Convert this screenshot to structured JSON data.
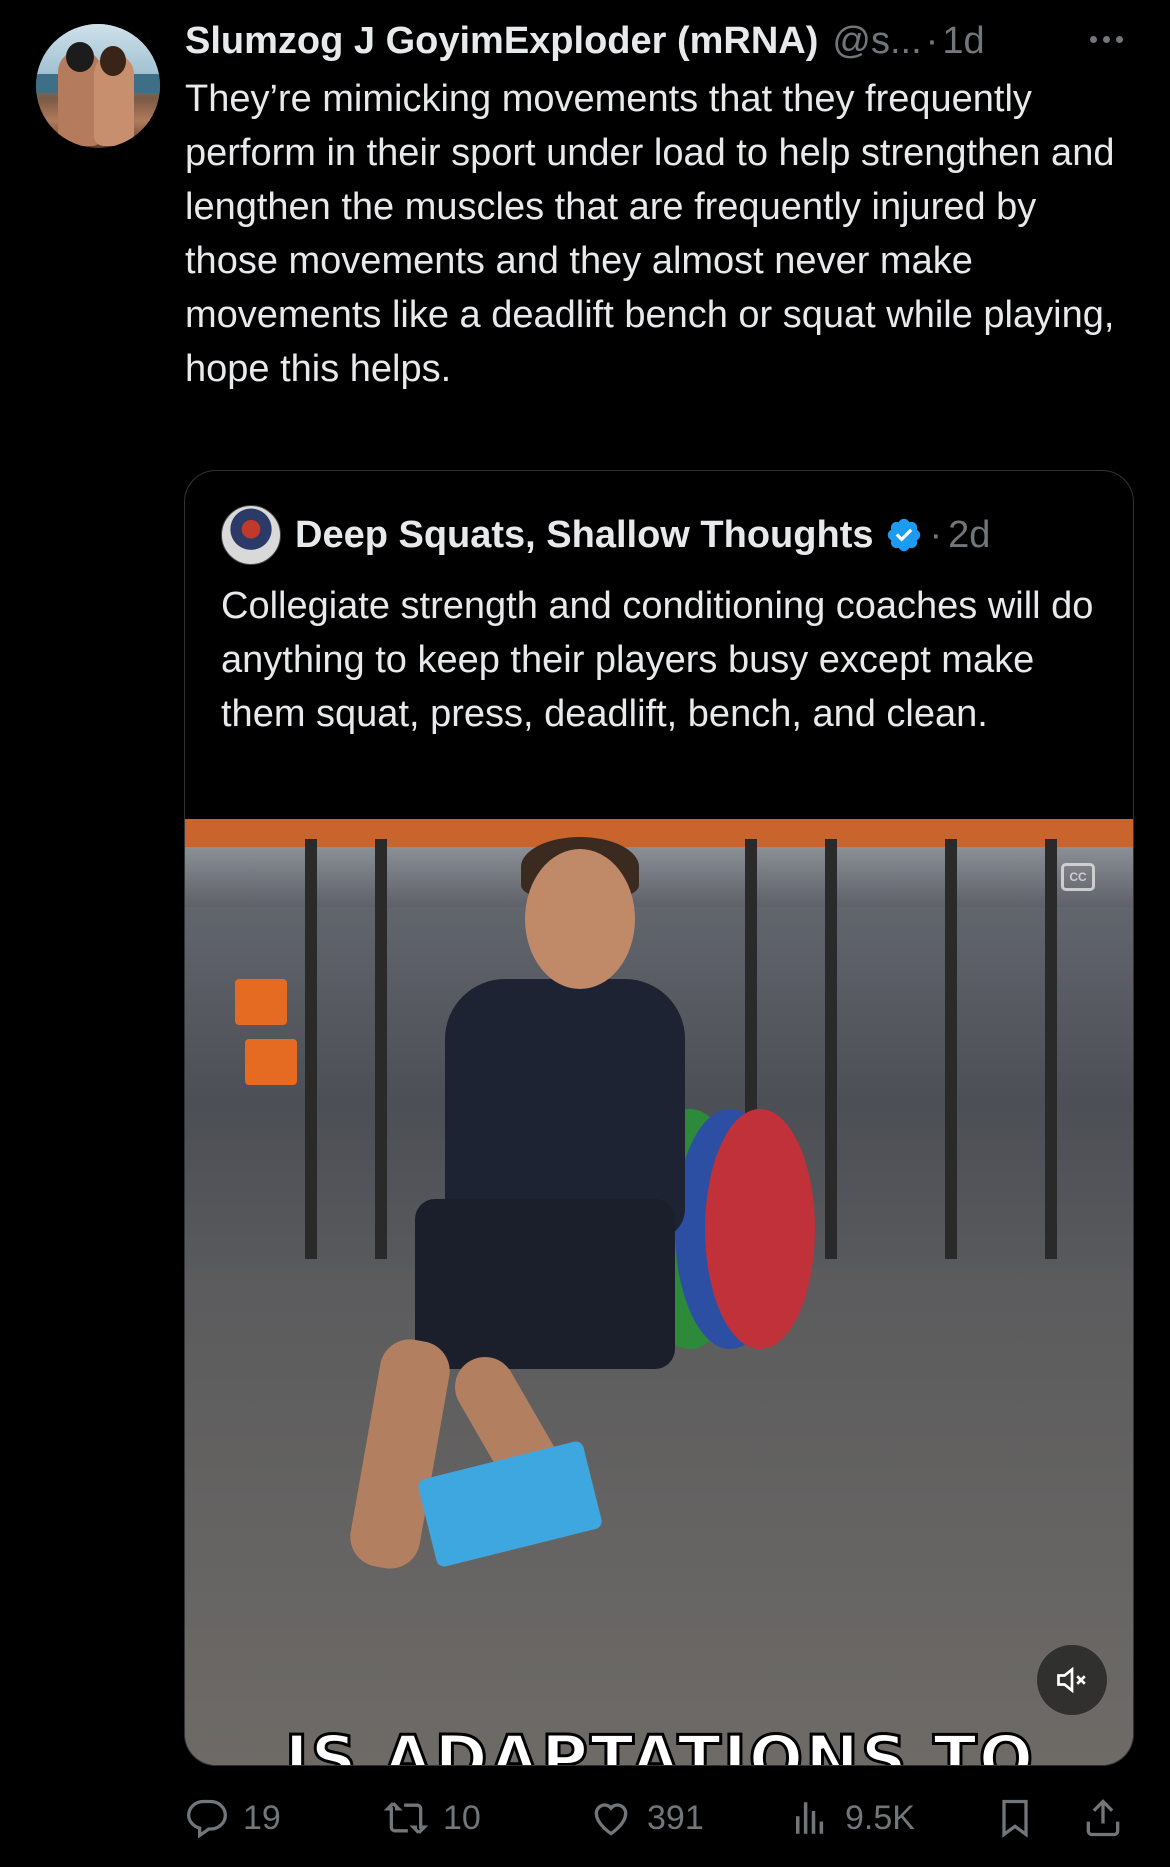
{
  "tweet": {
    "display_name": "Slumzog J GoyimExploder (mRNA)",
    "handle": "@s...",
    "separator": "·",
    "time": "1d",
    "text": "They’re mimicking movements that they frequently perform in their sport under load to help strengthen and lengthen the muscles that are frequently injured by those movements and they almost never make movements like a deadlift bench or squat while playing, hope this helps."
  },
  "quote": {
    "display_name": "Deep Squats, Shallow Thoughts",
    "separator": "·",
    "time": "2d",
    "text": "Collegiate strength and conditioning coaches will do anything to keep their players busy except make them squat, press, deadlift, bench, and clean.",
    "media": {
      "caption": "IS ADAPTATIONS TO",
      "cc_label": "CC"
    }
  },
  "actions": {
    "replies": "19",
    "reposts": "10",
    "likes": "391",
    "views": "9.5K"
  },
  "colors": {
    "background": "#000000",
    "text": "#e7e9ea",
    "muted": "#71767b",
    "border": "#2f3336",
    "verified": "#1d9bf0"
  }
}
